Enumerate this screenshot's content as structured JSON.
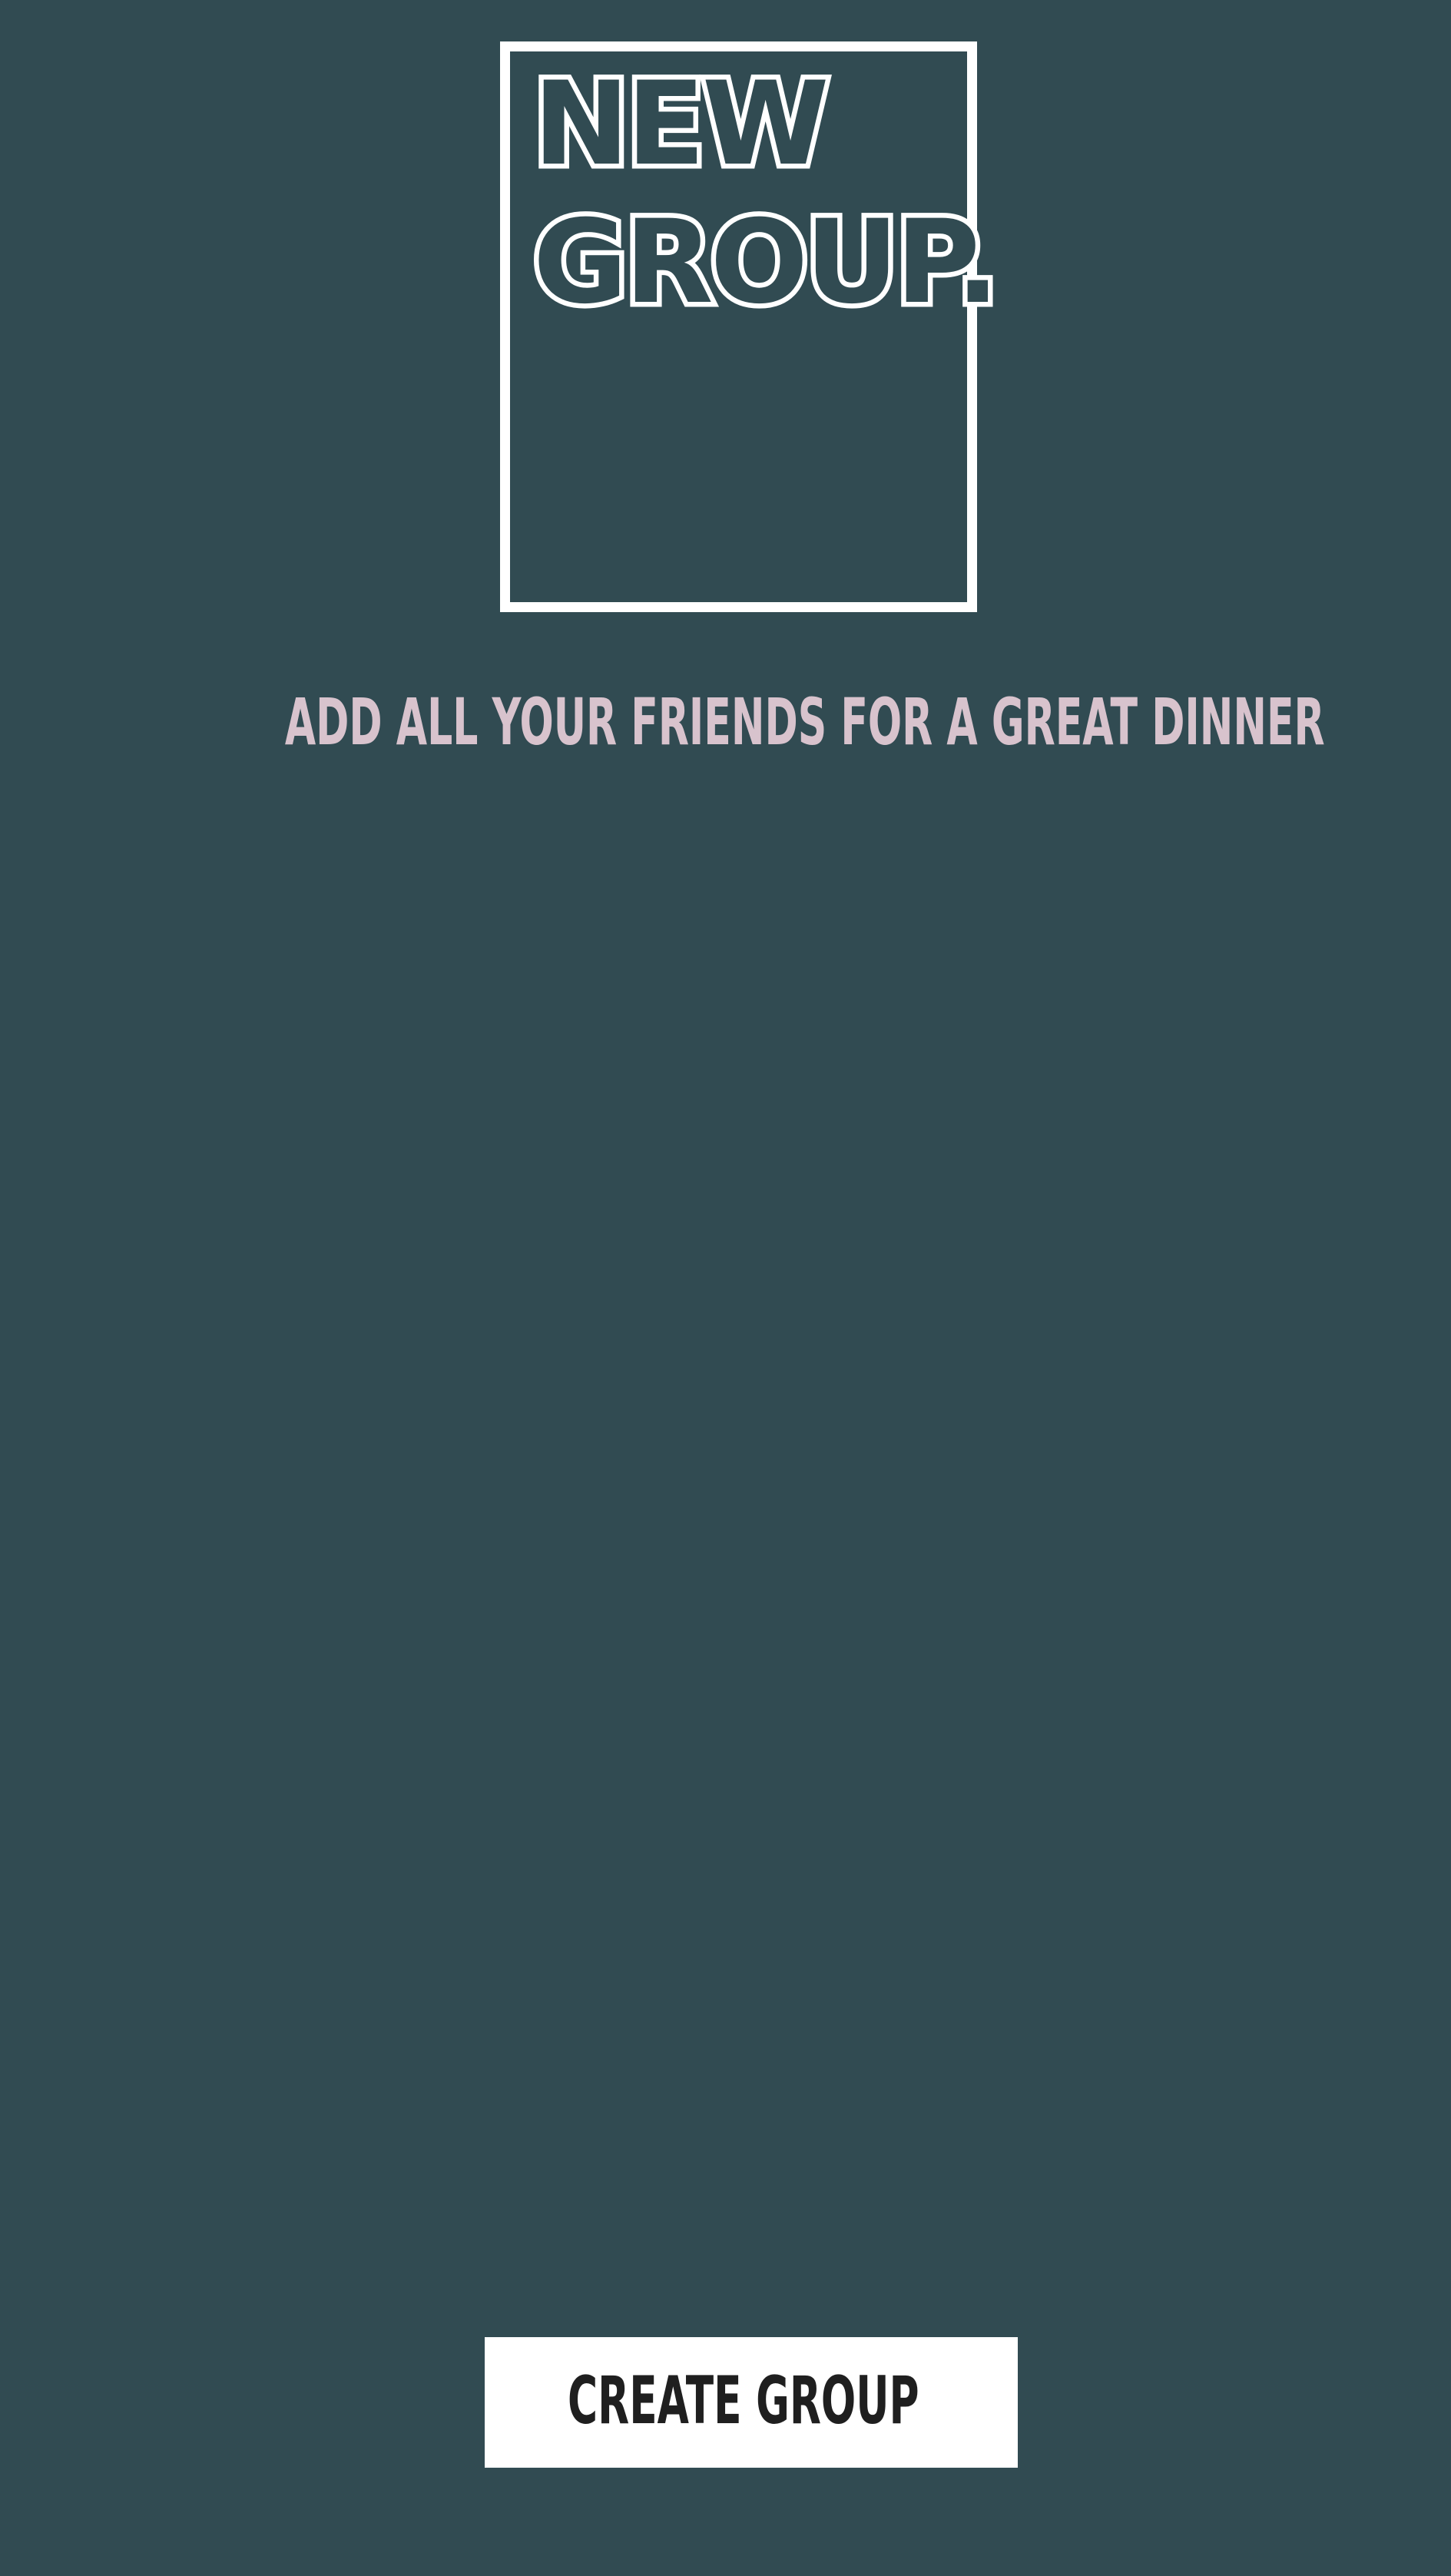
{
  "header": {
    "title_line1": "NEW",
    "title_line2": "GROUP."
  },
  "main": {
    "tagline": "ADD ALL YOUR FRIENDS FOR A GREAT DINNER"
  },
  "footer": {
    "create_button_label": "CREATE GROUP"
  },
  "colors": {
    "background": "#314b52",
    "title_outline": "#ffffff",
    "tagline": "#d8c3cd",
    "button_background": "#ffffff",
    "button_text": "#1f1f1f"
  }
}
